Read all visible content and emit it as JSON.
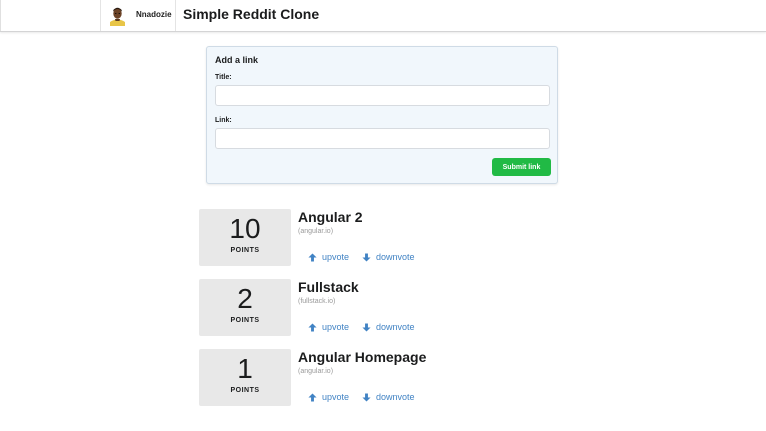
{
  "header": {
    "user_name": "Nnadozie",
    "app_title": "Simple Reddit Clone"
  },
  "form": {
    "heading": "Add a link",
    "title_label": "Title:",
    "title_value": "",
    "link_label": "Link:",
    "link_value": "",
    "submit_label": "Submit link",
    "submit_color": "#21ba45"
  },
  "articles": [
    {
      "votes": "10",
      "points_label": "POINTS",
      "title": "Angular 2",
      "domain": "(angular.io)",
      "upvote_label": "upvote",
      "downvote_label": "downvote"
    },
    {
      "votes": "2",
      "points_label": "POINTS",
      "title": "Fullstack",
      "domain": "(fullstack.io)",
      "upvote_label": "upvote",
      "downvote_label": "downvote"
    },
    {
      "votes": "1",
      "points_label": "POINTS",
      "title": "Angular Homepage",
      "domain": "(angular.io)",
      "upvote_label": "upvote",
      "downvote_label": "downvote"
    }
  ],
  "colors": {
    "link": "#4183c4",
    "score_box": "#e8e8e8",
    "form_background": "#f1f7fc"
  },
  "icons": {
    "upvote": "arrow-up-icon",
    "downvote": "arrow-down-icon"
  }
}
